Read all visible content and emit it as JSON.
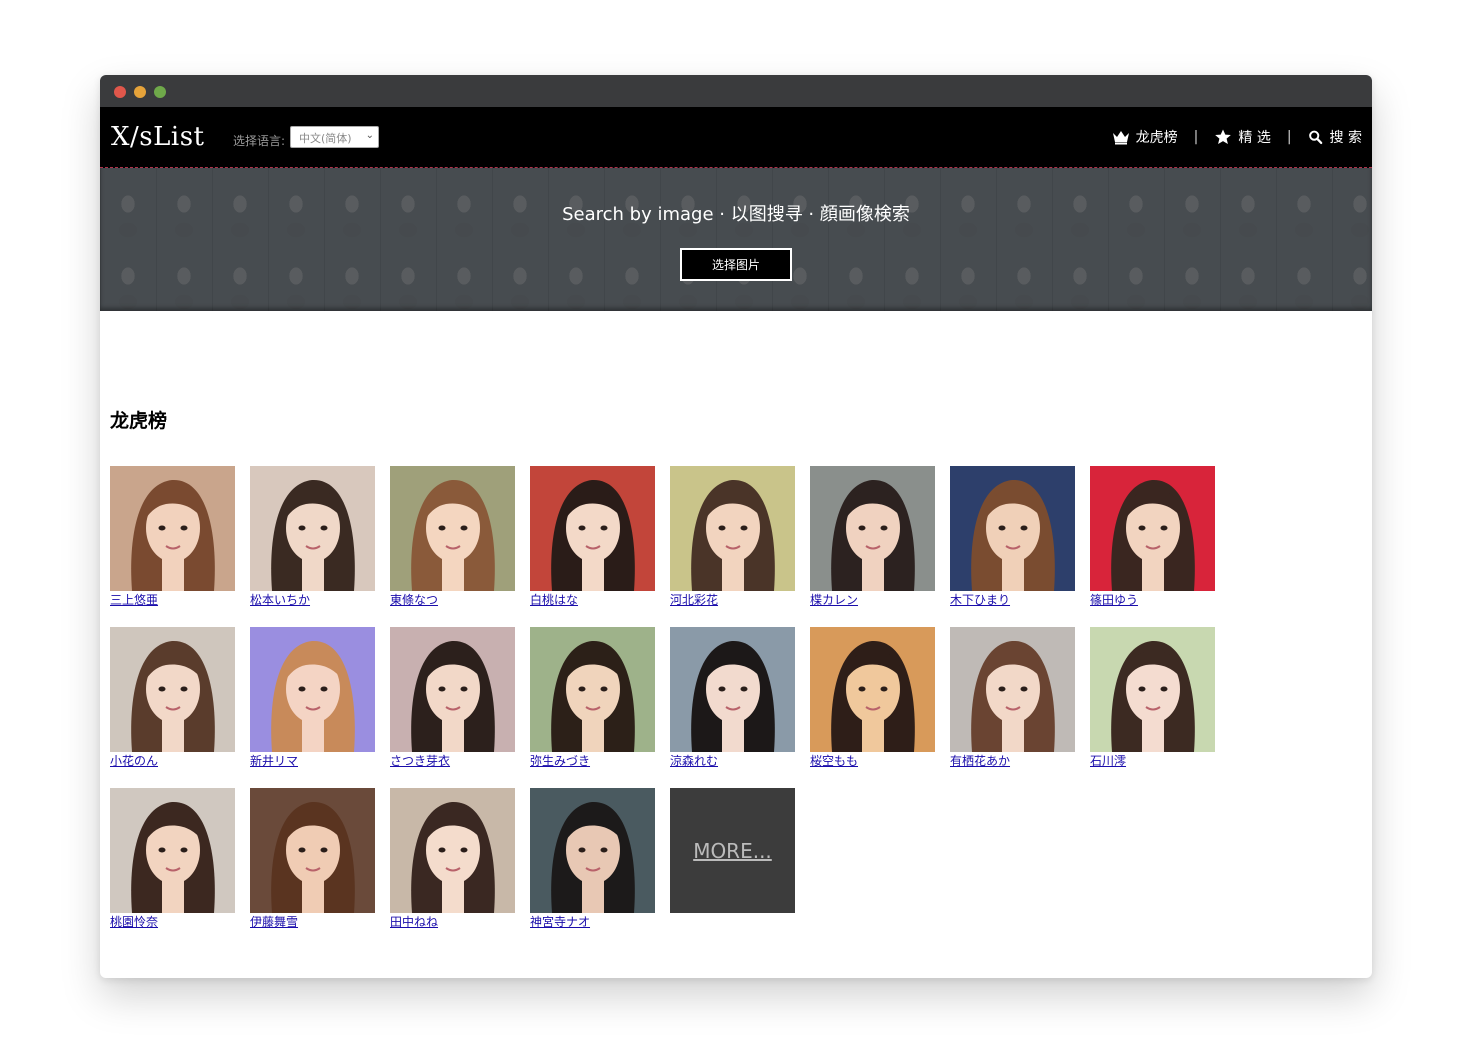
{
  "app": {
    "logo": "X/sList"
  },
  "nav": {
    "language_label": "选择语言:",
    "language_selected": "中文(简体)",
    "links": [
      {
        "label": "龙虎榜",
        "icon": "crown-icon"
      },
      {
        "label": "精 选",
        "icon": "star-icon"
      },
      {
        "label": "搜 索",
        "icon": "search-icon"
      }
    ],
    "separator": "|"
  },
  "hero": {
    "title": "Search by image · 以图搜寻 · 顔画像検索",
    "button": "选择图片"
  },
  "section": {
    "title": "龙虎榜"
  },
  "cards": [
    {
      "name": "三上悠亜",
      "bg": "#c9a58c",
      "hair": "#7a4a30",
      "skin": "#f2d2bd"
    },
    {
      "name": "松本いちか",
      "bg": "#d8c8bd",
      "hair": "#3a2a22",
      "skin": "#f0d8c8"
    },
    {
      "name": "東條なつ",
      "bg": "#9fa07a",
      "hair": "#8a5a3a",
      "skin": "#f4d6c0"
    },
    {
      "name": "白桃はな",
      "bg": "#c2453a",
      "hair": "#2a1c18",
      "skin": "#f3d9c8"
    },
    {
      "name": "河北彩花",
      "bg": "#c9c48a",
      "hair": "#4a3428",
      "skin": "#f2d4bf"
    },
    {
      "name": "楪カレン",
      "bg": "#8a8f8c",
      "hair": "#2c2220",
      "skin": "#f0d2c0"
    },
    {
      "name": "木下ひまり",
      "bg": "#2d3f6b",
      "hair": "#7a4c30",
      "skin": "#f0d0b8"
    },
    {
      "name": "篠田ゆう",
      "bg": "#d8243a",
      "hair": "#3a2620",
      "skin": "#f2d4c0"
    },
    {
      "name": "小花のん",
      "bg": "#cfc6bd",
      "hair": "#5a3c2c",
      "skin": "#f2d8c8"
    },
    {
      "name": "新井リマ",
      "bg": "#9a8ee0",
      "hair": "#c88a5a",
      "skin": "#f4d4c4"
    },
    {
      "name": "さつき芽衣",
      "bg": "#c8b0b0",
      "hair": "#2c201c",
      "skin": "#f2d8c8"
    },
    {
      "name": "弥生みづき",
      "bg": "#9eb28a",
      "hair": "#2c2018",
      "skin": "#f0d4bc"
    },
    {
      "name": "涼森れむ",
      "bg": "#8a9aa8",
      "hair": "#1c1818",
      "skin": "#f2dace"
    },
    {
      "name": "桜空もも",
      "bg": "#d89a5a",
      "hair": "#2e1e18",
      "skin": "#f0c89c"
    },
    {
      "name": "有栖花あか",
      "bg": "#bfbab6",
      "hair": "#6a4432",
      "skin": "#f2d8c8"
    },
    {
      "name": "石川澪",
      "bg": "#c8d8b0",
      "hair": "#3c2a22",
      "skin": "#f4dcd0"
    },
    {
      "name": "桃園怜奈",
      "bg": "#d0c8c0",
      "hair": "#3c2820",
      "skin": "#f2d4c0"
    },
    {
      "name": "伊藤舞雪",
      "bg": "#6a4a3a",
      "hair": "#5a3420",
      "skin": "#f0ccb4"
    },
    {
      "name": "田中ねね",
      "bg": "#c8b8a8",
      "hair": "#3a2822",
      "skin": "#f4dccc"
    },
    {
      "name": "神宮寺ナオ",
      "bg": "#4a5a60",
      "hair": "#1c1a1a",
      "skin": "#e8c8b4"
    }
  ],
  "more": {
    "label": "MORE..."
  }
}
